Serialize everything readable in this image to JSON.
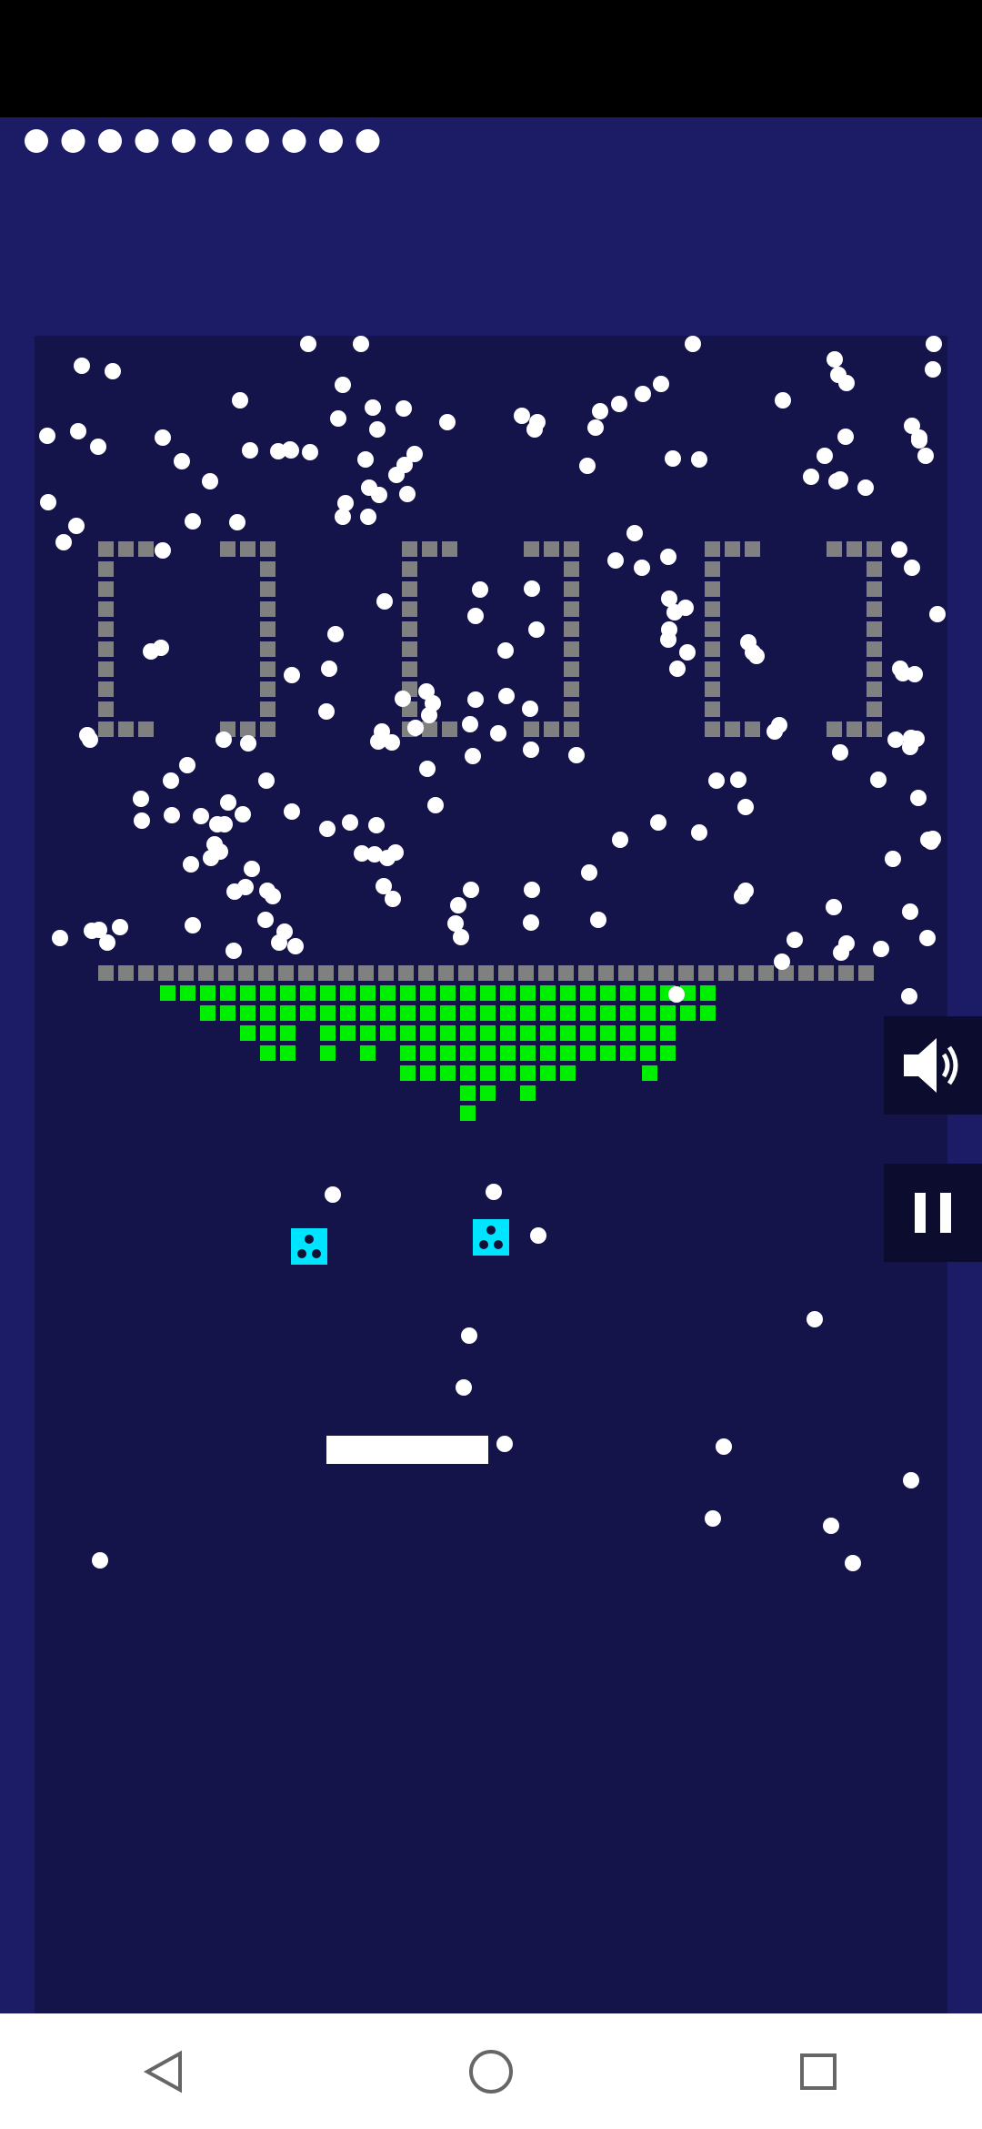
{
  "game": {
    "lives": 10,
    "colors": {
      "hud_bg": "#1b1b66",
      "field_bg": "#14144a",
      "ball": "#ffffff",
      "gray_brick": "#808080",
      "green_brick": "#00ee00",
      "powerup": "#00e5ff",
      "paddle": "#ffffff"
    },
    "powerups": [
      {
        "name": "multiball-powerup",
        "icon": "three-dots-icon"
      },
      {
        "name": "multiball-powerup",
        "icon": "three-dots-icon"
      }
    ],
    "controls": {
      "sound_icon": "speaker-icon",
      "pause_icon": "pause-icon"
    }
  },
  "navbar": {
    "back_icon": "back-triangle-icon",
    "home_icon": "home-circle-icon",
    "recents_icon": "recents-square-icon"
  }
}
